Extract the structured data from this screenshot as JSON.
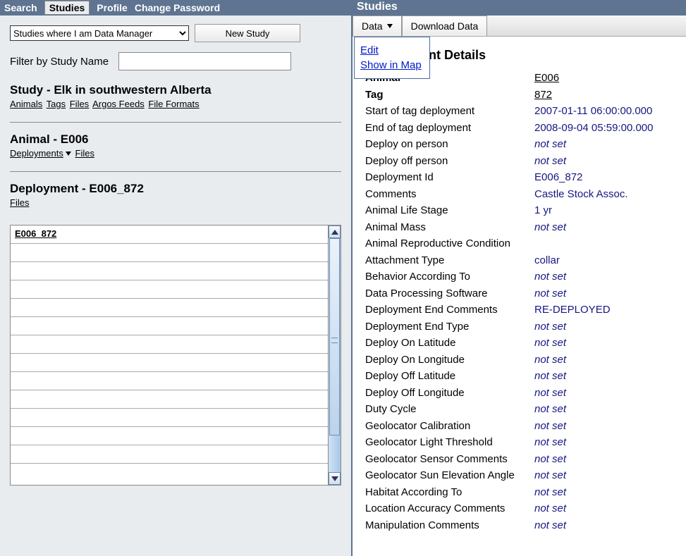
{
  "top_nav": {
    "items": [
      "Search",
      "Studies",
      "Profile",
      "Change Password"
    ],
    "active_index": 1
  },
  "left_pane": {
    "study_select": {
      "selected": "Studies where I am Data Manager"
    },
    "new_study_btn": "New Study",
    "filter": {
      "label": "Filter by Study Name",
      "value": ""
    },
    "study_section": {
      "title": "Study - Elk in southwestern Alberta",
      "links": [
        "Animals",
        "Tags",
        "Files",
        "Argos Feeds",
        "File Formats"
      ]
    },
    "animal_section": {
      "title": "Animal - E006",
      "links": [
        "Deployments",
        "Files"
      ],
      "has_caret_on": 0
    },
    "deployment_section": {
      "title": "Deployment - E006_872",
      "links": [
        "Files"
      ]
    },
    "list": {
      "rows": [
        "E006_872",
        "",
        "",
        "",
        "",
        "",
        "",
        "",
        "",
        "",
        "",
        "",
        ""
      ]
    }
  },
  "right_pane": {
    "header": "Studies",
    "tabs": [
      {
        "label": "Data",
        "has_caret": true
      },
      {
        "label": "Download Data",
        "has_caret": false
      }
    ],
    "dropdown": {
      "items": [
        "Edit",
        "Show in Map"
      ]
    },
    "details_title_suffix": "nt Details",
    "details": [
      {
        "label": "Animal",
        "value": "E006",
        "bold_label": true,
        "link": true
      },
      {
        "label": "Tag",
        "value": "872",
        "bold_label": true,
        "link": true
      },
      {
        "label": "Start of tag deployment",
        "value": "2007-01-11 06:00:00.000"
      },
      {
        "label": "End of tag deployment",
        "value": "2008-09-04 05:59:00.000"
      },
      {
        "label": "Deploy on person",
        "value": "not set",
        "notset": true
      },
      {
        "label": "Deploy off person",
        "value": "not set",
        "notset": true
      },
      {
        "label": "Deployment Id",
        "value": "E006_872"
      },
      {
        "label": "Comments",
        "value": "Castle Stock Assoc."
      },
      {
        "label": "Animal Life Stage",
        "value": "1 yr"
      },
      {
        "label": "Animal Mass",
        "value": "not set",
        "notset": true
      },
      {
        "label": "Animal Reproductive Condition",
        "value": ""
      },
      {
        "label": "Attachment Type",
        "value": "collar"
      },
      {
        "label": "Behavior According To",
        "value": "not set",
        "notset": true
      },
      {
        "label": "Data Processing Software",
        "value": "not set",
        "notset": true
      },
      {
        "label": "Deployment End Comments",
        "value": "RE-DEPLOYED"
      },
      {
        "label": "Deployment End Type",
        "value": "not set",
        "notset": true
      },
      {
        "label": "Deploy On Latitude",
        "value": "not set",
        "notset": true
      },
      {
        "label": "Deploy On Longitude",
        "value": "not set",
        "notset": true
      },
      {
        "label": "Deploy Off Latitude",
        "value": "not set",
        "notset": true
      },
      {
        "label": "Deploy Off Longitude",
        "value": "not set",
        "notset": true
      },
      {
        "label": "Duty Cycle",
        "value": "not set",
        "notset": true
      },
      {
        "label": "Geolocator Calibration",
        "value": "not set",
        "notset": true
      },
      {
        "label": "Geolocator Light Threshold",
        "value": "not set",
        "notset": true
      },
      {
        "label": "Geolocator Sensor Comments",
        "value": "not set",
        "notset": true
      },
      {
        "label": "Geolocator Sun Elevation Angle",
        "value": "not set",
        "notset": true
      },
      {
        "label": "Habitat According To",
        "value": "not set",
        "notset": true
      },
      {
        "label": "Location Accuracy Comments",
        "value": "not set",
        "notset": true
      },
      {
        "label": "Manipulation Comments",
        "value": "not set",
        "notset": true
      }
    ]
  }
}
